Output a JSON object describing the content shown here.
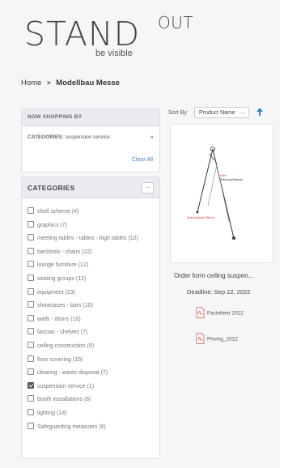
{
  "logo": {
    "main": "STAND",
    "superscript": "OUT",
    "tagline": "be visible"
  },
  "breadcrumb": {
    "home": "Home",
    "separator": ">",
    "current": "Modellbau Messe"
  },
  "now_shopping": {
    "title": "NOW SHOPPING BY",
    "filter_label": "CATEGORIES:",
    "filter_value": "suspension service",
    "remove": "×",
    "clear_all": "Clear All"
  },
  "categories": {
    "title": "CATEGORIES",
    "collapse": "-",
    "items": [
      {
        "label": "shell scheme (4)",
        "checked": false
      },
      {
        "label": "graphics (7)",
        "checked": false
      },
      {
        "label": "meeting tables - tables - high tables (12)",
        "checked": false
      },
      {
        "label": "barstools - chairs (22)",
        "checked": false
      },
      {
        "label": "lounge furniture (12)",
        "checked": false
      },
      {
        "label": "seating groups (12)",
        "checked": false
      },
      {
        "label": "equipment (23)",
        "checked": false
      },
      {
        "label": "showcases - bars (10)",
        "checked": false
      },
      {
        "label": "walls - doors (10)",
        "checked": false
      },
      {
        "label": "fascias - shelves (7)",
        "checked": false
      },
      {
        "label": "ceiling construction (9)",
        "checked": false
      },
      {
        "label": "floor covering (15)",
        "checked": false
      },
      {
        "label": "clearing - waste disposal (7)",
        "checked": false
      },
      {
        "label": "suspension service (1)",
        "checked": true
      },
      {
        "label": "booth installations (6)",
        "checked": false
      },
      {
        "label": "lighting (14)",
        "checked": false
      },
      {
        "label": "Safeguarding measures (6)",
        "checked": false
      }
    ]
  },
  "sort": {
    "label": "Sort By",
    "selected": "Product Name",
    "direction_icon": "arrow-up"
  },
  "product": {
    "title": "Order form ceiling suspen...",
    "deadline": "Deadline: Sep 22, 2022",
    "image_labels": {
      "red_top": "Höhe",
      "red_bottom": "Schnurabstand Öffnung",
      "black_right": "Sicherung Seilende"
    },
    "attachments": [
      {
        "label": "Factsheet 2022"
      },
      {
        "label": "Pricing_2022"
      }
    ]
  },
  "colors": {
    "accent": "#3d7fc9",
    "pdf_red": "#d9534f",
    "panel_header": "#e9ebef"
  }
}
